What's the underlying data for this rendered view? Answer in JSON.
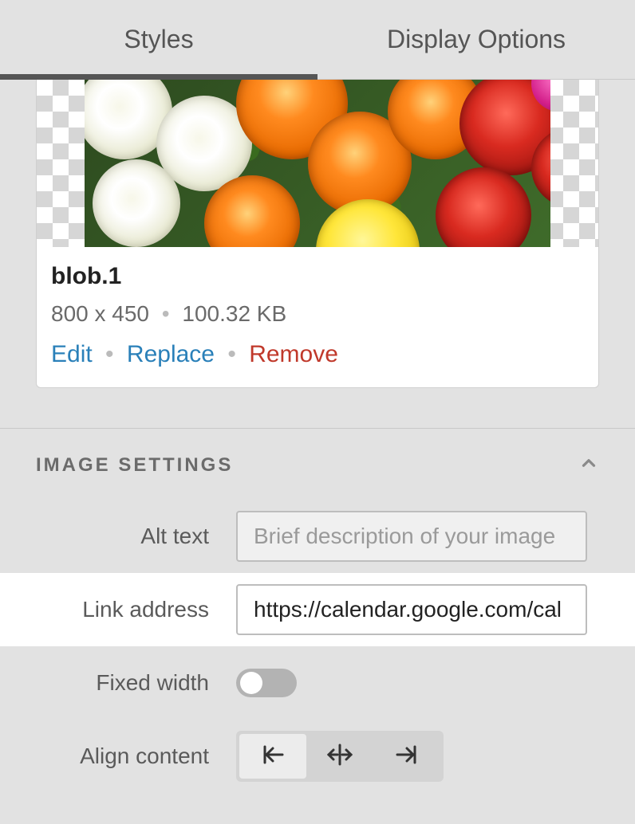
{
  "tabs": {
    "styles": "Styles",
    "display_options": "Display Options",
    "active": "styles"
  },
  "image": {
    "filename": "blob.1",
    "dimensions": "800 x 450",
    "filesize": "100.32 KB",
    "actions": {
      "edit": "Edit",
      "replace": "Replace",
      "remove": "Remove"
    }
  },
  "section": {
    "title": "IMAGE SETTINGS",
    "expanded": true
  },
  "settings": {
    "alt_text": {
      "label": "Alt text",
      "placeholder": "Brief description of your image",
      "value": ""
    },
    "link_address": {
      "label": "Link address",
      "value": "https://calendar.google.com/cal"
    },
    "fixed_width": {
      "label": "Fixed width",
      "value": false
    },
    "align_content": {
      "label": "Align content",
      "value": "left"
    }
  }
}
